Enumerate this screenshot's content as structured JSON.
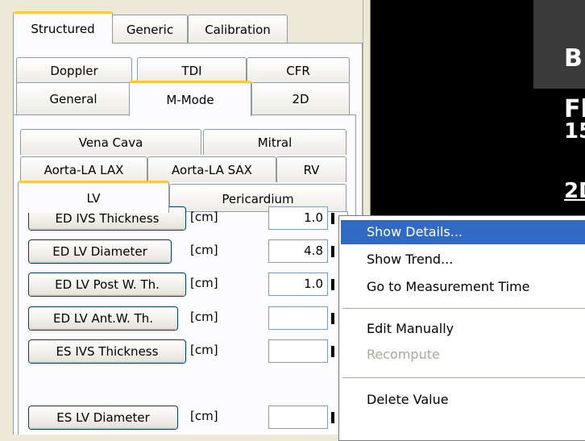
{
  "top_tabs": [
    "Structured",
    "Generic",
    "Calibration"
  ],
  "category_tabs": {
    "row1": [
      "Doppler",
      "TDI",
      "CFR"
    ],
    "row2": [
      "General",
      "M-Mode",
      "2D"
    ]
  },
  "section_tabs": {
    "row1": [
      "Vena Cava",
      "Mitral"
    ],
    "row2": [
      "Aorta-LA LAX",
      "Aorta-LA SAX",
      "RV"
    ],
    "row3": [
      "LV",
      "Pericardium"
    ]
  },
  "measurements": [
    {
      "label": "ED IVS Thickness",
      "unit": "[cm]",
      "value": "1.0"
    },
    {
      "label": "ED LV Diameter",
      "unit": "[cm]",
      "value": "4.8"
    },
    {
      "label": "ED LV Post W. Th.",
      "unit": "[cm]",
      "value": "1.0"
    },
    {
      "label": "ED LV Ant.W. Th.",
      "unit": "[cm]",
      "value": ""
    },
    {
      "label": "ES IVS Thickness",
      "unit": "[cm]",
      "value": ""
    },
    {
      "label": "ES LV Diameter",
      "unit": "[cm]",
      "value": ""
    }
  ],
  "context_menu": {
    "items": [
      "Show Details...",
      "Show Trend...",
      "Go to Measurement Time",
      "Edit Manually",
      "Recompute",
      "Delete Value"
    ],
    "highlighted": "Show Details...",
    "disabled": [
      "Recompute"
    ]
  },
  "image_overlay": {
    "text1": "B",
    "text2": "Fl",
    "text3": "15",
    "text4": "2D"
  },
  "colors": {
    "selected_tab_accent": "#ffc83c",
    "menu_highlight": "#316ac5",
    "panel_bg": "#ece9d8",
    "image_bg": "#000000"
  }
}
